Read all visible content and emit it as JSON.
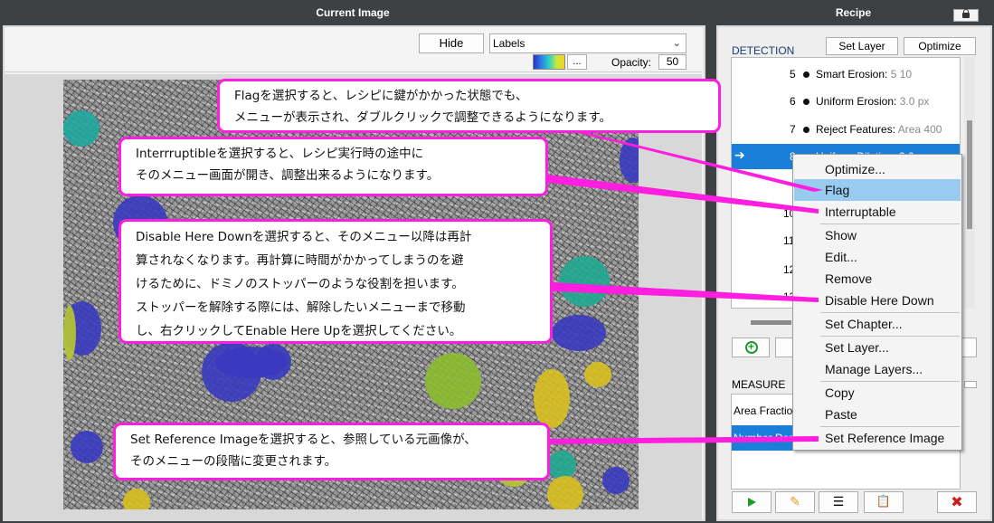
{
  "panels": {
    "current_image_title": "Current Image",
    "recipe_title": "Recipe"
  },
  "toolbar": {
    "hide_label": "Hide",
    "labels_value": "Labels",
    "dots_label": "...",
    "opacity_label": "Opacity:",
    "opacity_value": "50"
  },
  "recipe": {
    "detection_label": "DETECTION",
    "set_layer_label": "Set Layer",
    "optimize_label": "Optimize",
    "steps": [
      {
        "num": "5",
        "name": "Smart Erosion:",
        "value": "5 10"
      },
      {
        "num": "6",
        "name": "Uniform Erosion:",
        "value": "3.0 px"
      },
      {
        "num": "7",
        "name": "Reject Features:",
        "value": "Area 400"
      },
      {
        "num": "8",
        "name": "Uniform Dilation:",
        "value": "3.0"
      }
    ],
    "hidden_step_nums": [
      "10",
      "11",
      "12",
      "13"
    ],
    "measure_label": "MEASURE",
    "measure_rows": [
      "Area Fraction",
      "Number Density"
    ]
  },
  "context_menu": {
    "items": [
      "Optimize...",
      "Flag",
      "Interruptable",
      "Show",
      "Edit...",
      "Remove",
      "Disable Here Down",
      "Set Chapter...",
      "Set Layer...",
      "Manage Layers...",
      "Copy",
      "Paste",
      "Set Reference Image"
    ],
    "highlighted": "Flag"
  },
  "callouts": {
    "flag": "Flagを選択すると、レシピに鍵がかかった状態でも、\nメニューが表示され、ダブルクリックで調整できるようになります。",
    "interruptible": "Interrruptibleを選択すると、レシピ実行時の途中に\nそのメニュー画面が開き、調整出来るようになります。",
    "disable": "Disable Here Downを選択すると、そのメニュー以降は再計\n算されなくなります。再計算に時間がかかってしまうのを避\nけるために、ドミノのストッパーのような役割を担います。\nストッパーを解除する際には、解除したいメニューまで移動\nし、右クリックしてEnable Here Upを選択してください。",
    "reference": "Set Reference Imageを選択すると、参照している元画像が、\nそのメニューの段階に変更されます。"
  },
  "colors": {
    "background": "#3d4144",
    "accent_callout": "#ff1ee0",
    "selection": "#1a7fd8",
    "menu_highlight": "#99cbf0"
  },
  "icons": [
    "lock-icon",
    "add-step-icon",
    "play-icon",
    "pencil-icon",
    "list-icon",
    "clipboard-icon",
    "delete-icon",
    "arrow-right-icon",
    "chevron-down-icon"
  ]
}
